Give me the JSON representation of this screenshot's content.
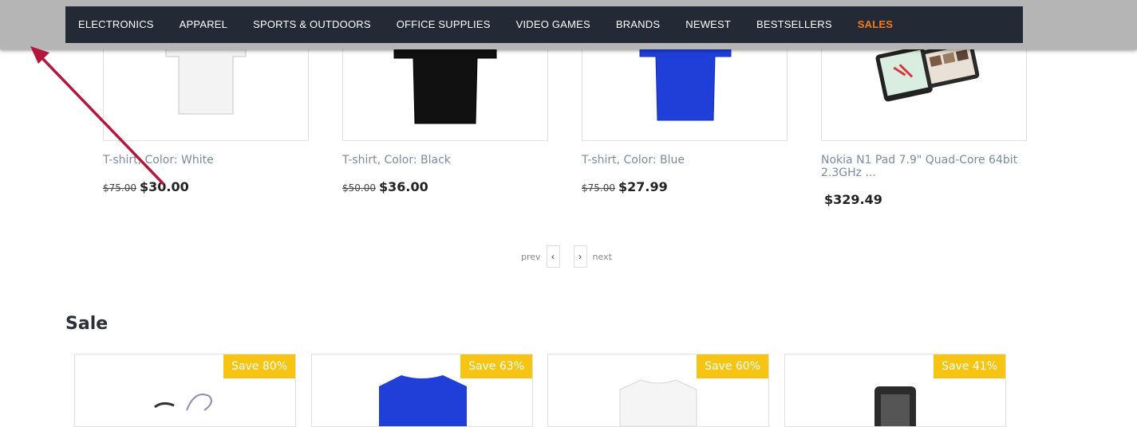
{
  "nav": {
    "items": [
      {
        "label": "ELECTRONICS"
      },
      {
        "label": "APPAREL"
      },
      {
        "label": "SPORTS & OUTDOORS"
      },
      {
        "label": "OFFICE SUPPLIES"
      },
      {
        "label": "VIDEO GAMES"
      },
      {
        "label": "BRANDS"
      },
      {
        "label": "NEWEST"
      },
      {
        "label": "BESTSELLERS"
      },
      {
        "label": "SALES"
      }
    ]
  },
  "products": [
    {
      "name": "T-shirt, Color: White",
      "old_price": "$75.00",
      "price": "$30.00",
      "image": "white-tshirt"
    },
    {
      "name": "T-shirt, Color: Black",
      "old_price": "$50.00",
      "price": "$36.00",
      "image": "black-tshirt"
    },
    {
      "name": "T-shirt, Color: Blue",
      "old_price": "$75.00",
      "price": "$27.99",
      "image": "blue-tshirt"
    },
    {
      "name": "Nokia N1 Pad 7.9\" Quad-Core 64bit 2.3GHz ...",
      "old_price": "",
      "price": "$329.49",
      "image": "tablet"
    }
  ],
  "pager": {
    "prev": "prev",
    "next": "next"
  },
  "sale": {
    "title": "Sale",
    "items": [
      {
        "badge": "Save 80%",
        "image": "bicycle-parts"
      },
      {
        "badge": "Save 63%",
        "image": "blue-tshirt"
      },
      {
        "badge": "Save 60%",
        "image": "white-tshirt"
      },
      {
        "badge": "Save 41%",
        "image": "phone"
      }
    ]
  },
  "colors": {
    "nav_bg": "#232a36",
    "sales_accent": "#f27a1a",
    "badge": "#f6c412",
    "annotation_arrow": "#b5173c"
  }
}
